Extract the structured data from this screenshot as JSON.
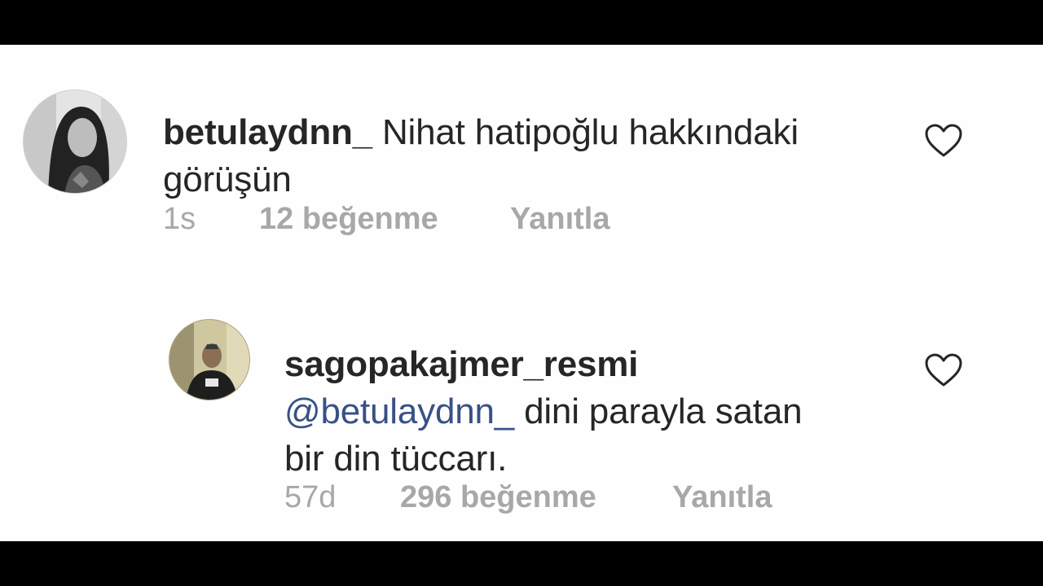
{
  "comments": [
    {
      "username": "betulaydnn_",
      "text_line1": "Nihat hatipoğlu hakkındaki",
      "text_line2": "görüşün",
      "time": "1s",
      "likes": "12 beğenme",
      "reply": "Yanıtla",
      "avatar_icon": "profile-photo-woman",
      "like_icon": "heart-outline-icon"
    },
    {
      "username": "sagopakajmer_resmi",
      "mention": "@betulaydnn_",
      "text_line1": "dini parayla satan",
      "text_line2": "bir din tüccarı.",
      "time": "57d",
      "likes": "296 beğenme",
      "reply": "Yanıtla",
      "avatar_icon": "profile-photo-man",
      "like_icon": "heart-outline-icon"
    }
  ],
  "colors": {
    "background": "#fefefe",
    "letterbox": "#000000",
    "text": "#262626",
    "mention": "#385185",
    "meta": "#a8a8a8"
  }
}
